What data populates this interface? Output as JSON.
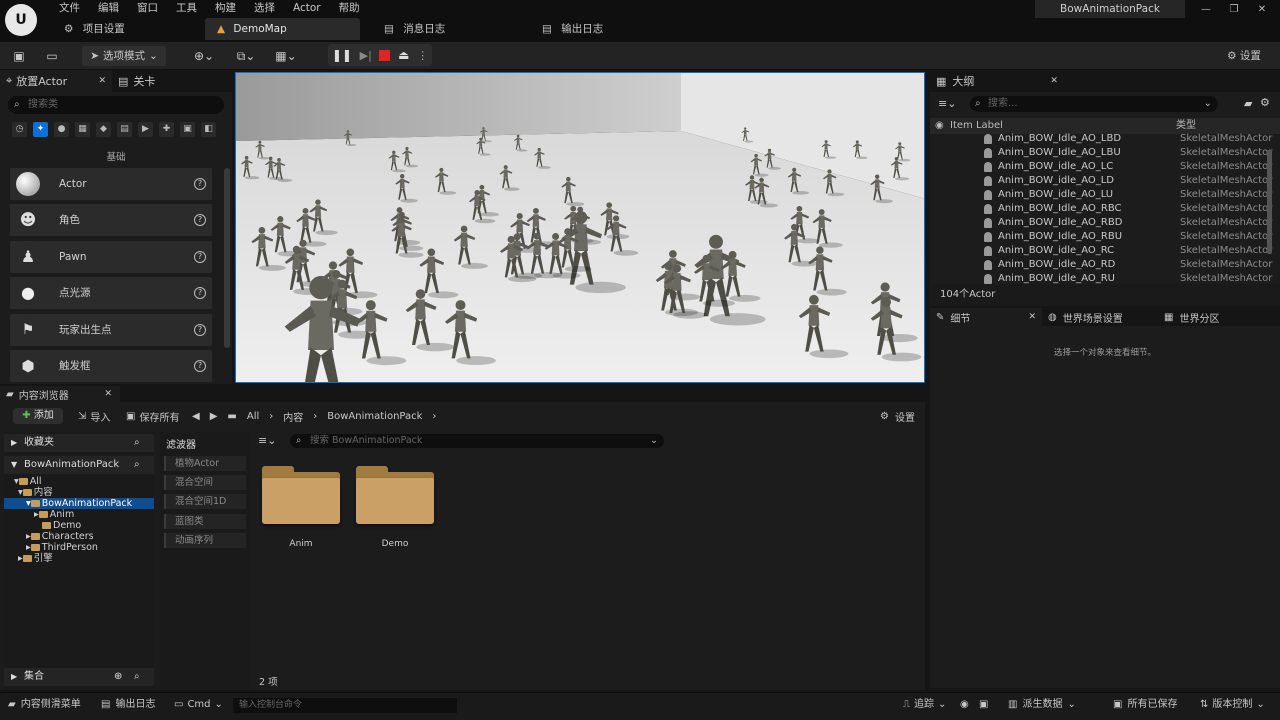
{
  "menu": [
    "文件",
    "编辑",
    "窗口",
    "工具",
    "构建",
    "选择",
    "Actor",
    "帮助"
  ],
  "app_title": "BowAnimationPack",
  "top_tabs": {
    "project_settings": "项目设置",
    "demomap": "DemoMap",
    "message_log": "消息日志",
    "output_log": "输出日志"
  },
  "toolbar": {
    "mode_label": "选项模式",
    "settings_label": "设置"
  },
  "place_actors": {
    "tab_label": "放置Actor",
    "levels_tab": "关卡",
    "search_placeholder": "搜索类",
    "category_label": "基础",
    "items": [
      "Actor",
      "角色",
      "Pawn",
      "点光源",
      "玩家出生点",
      "触发框"
    ]
  },
  "outliner": {
    "title": "大纲",
    "search_placeholder": "搜索...",
    "col_label": "Item Label",
    "col_type": "类型",
    "rows": [
      {
        "name": "Anim_BOW_Idle_AO_LBD",
        "type": "SkeletalMeshActor"
      },
      {
        "name": "Anim_BOW_Idle_AO_LBU",
        "type": "SkeletalMeshActor"
      },
      {
        "name": "Anim_BOW_idle_AO_LC",
        "type": "SkeletalMeshActor"
      },
      {
        "name": "Anim_BOW_idle_AO_LD",
        "type": "SkeletalMeshActor"
      },
      {
        "name": "Anim_BOW_idle_AO_LU",
        "type": "SkeletalMeshActor"
      },
      {
        "name": "Anim_BOW_Idle_AO_RBC",
        "type": "SkeletalMeshActor"
      },
      {
        "name": "Anim_BOW_Idle_AO_RBD",
        "type": "SkeletalMeshActor"
      },
      {
        "name": "Anim_BOW_Idle_AO_RBU",
        "type": "SkeletalMeshActor"
      },
      {
        "name": "Anim_BOW_idle_AO_RC",
        "type": "SkeletalMeshActor"
      },
      {
        "name": "Anim_BOW_idle_AO_RD",
        "type": "SkeletalMeshActor"
      },
      {
        "name": "Anim_BOW_idle_AO_RU",
        "type": "SkeletalMeshActor"
      }
    ],
    "actor_count": "104个Actor"
  },
  "details": {
    "tab_details": "细节",
    "tab_world_settings": "世界场景设置",
    "tab_world_partition": "世界分区",
    "empty_message": "选择一个对象来查看细节。"
  },
  "content_browser": {
    "tab_label": "内容浏览器",
    "add_label": "添加",
    "import_label": "导入",
    "save_all_label": "保存所有",
    "breadcrumb": [
      "All",
      "内容",
      "BowAnimationPack"
    ],
    "settings_label": "设置",
    "favorites_label": "收藏夹",
    "project_label": "BowAnimationPack",
    "tree": [
      "All",
      "内容",
      "BowAnimationPack",
      "Anim",
      "Demo",
      "Characters",
      "ThirdPerson",
      "引擎"
    ],
    "collections_label": "集合",
    "filters_label": "滤波器",
    "filter_items": [
      "植物Actor",
      "混合空间",
      "混合空间1D",
      "蓝图类",
      "动画序列"
    ],
    "search_placeholder": "搜索 BowAnimationPack",
    "folders": [
      "Anim",
      "Demo"
    ],
    "item_count": "2 项"
  },
  "statusbar": {
    "content_drawer": "内容侧滑菜单",
    "output_log": "输出日志",
    "cmd_label": "Cmd",
    "console_placeholder": "输入控制台命令",
    "trace_label": "追踪",
    "derived_data": "派生数据",
    "all_saved": "所有已保存",
    "source_control": "版本控制"
  },
  "colors": {
    "accent": "#0e6fd6",
    "folder": "#caa066",
    "selection": "#0d4d91"
  }
}
